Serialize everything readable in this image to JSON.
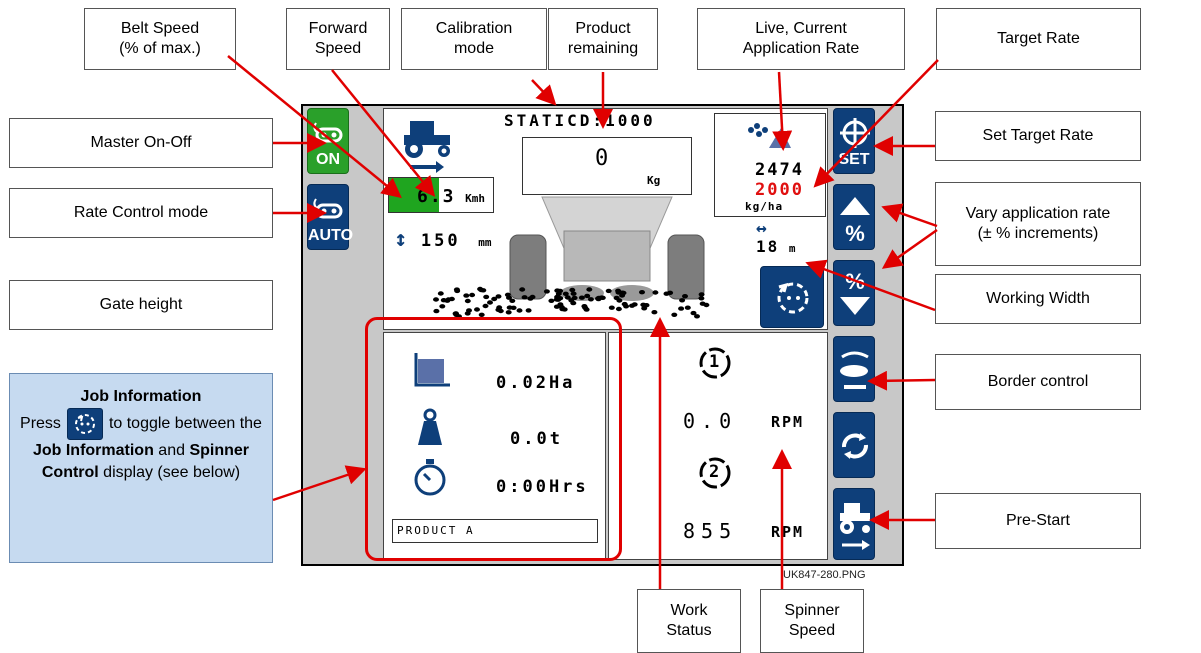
{
  "callouts": {
    "belt_speed": "Belt Speed\n(% of max.)",
    "forward_speed": "Forward\nSpeed",
    "calibration_mode": "Calibration\nmode",
    "product_remaining": "Product\nremaining",
    "live_rate": "Live, Current\nApplication Rate",
    "target_rate": "Target Rate",
    "master_on_off": "Master On-Off",
    "set_target_rate": "Set Target Rate",
    "rate_control_mode": "Rate Control mode",
    "vary_rate": "Vary application rate\n(± % increments)",
    "gate_height": "Gate height",
    "working_width": "Working Width",
    "border_control": "Border control",
    "pre_start": "Pre-Start",
    "work_status": "Work\nStatus",
    "spinner_speed": "Spinner\nSpeed"
  },
  "job_info": {
    "title": "Job Information",
    "press": "Press",
    "text_a": "to toggle between the ",
    "bold_a": "Job Information",
    "text_b": " and ",
    "bold_b": "Spinner Control",
    "text_c": " display (see below)"
  },
  "screen": {
    "mode_label": "STATIC",
    "cal_value": "D:1000",
    "product_value": "0",
    "product_unit": "Kg",
    "speed_value": "6.3",
    "speed_unit": "Kmh",
    "belt_percent": 48,
    "gate_value": "150",
    "gate_unit": "mm",
    "live_rate": "2474",
    "target_rate": "2000",
    "rate_unit": "kg/ha",
    "width_value": "18",
    "width_unit": "m",
    "area_value": "0.02Ha",
    "weight_value": "0.0t",
    "time_value": "0:00Hrs",
    "product_name": "PRODUCT A",
    "spinner1_value": "0.0",
    "spinner2_value": "855",
    "rpm_unit": "RPM",
    "spinner1_num": "1",
    "spinner2_num": "2"
  },
  "buttons": {
    "on_label": "ON",
    "auto_label": "AUTO",
    "set_label": "SET",
    "pct_label": "%"
  },
  "figure_ref": "UK847-280.PNG",
  "colors": {
    "button_blue": "#0e3f7a",
    "button_green": "#2aa02a",
    "target_red": "#e01010",
    "arrow_red": "#e00000",
    "jobinfo_bg": "#c6daf0"
  },
  "icons": [
    "tractor-icon",
    "hopper-icon",
    "spinner-toggle-icon",
    "target-crosshair-icon",
    "percent-up-icon",
    "percent-down-icon",
    "border-spread-icon",
    "spinner-cycle-icon",
    "pre-start-tractor-icon",
    "area-icon",
    "weight-icon",
    "stopwatch-icon",
    "gate-height-icon",
    "width-arrows-icon",
    "granules-icon"
  ]
}
